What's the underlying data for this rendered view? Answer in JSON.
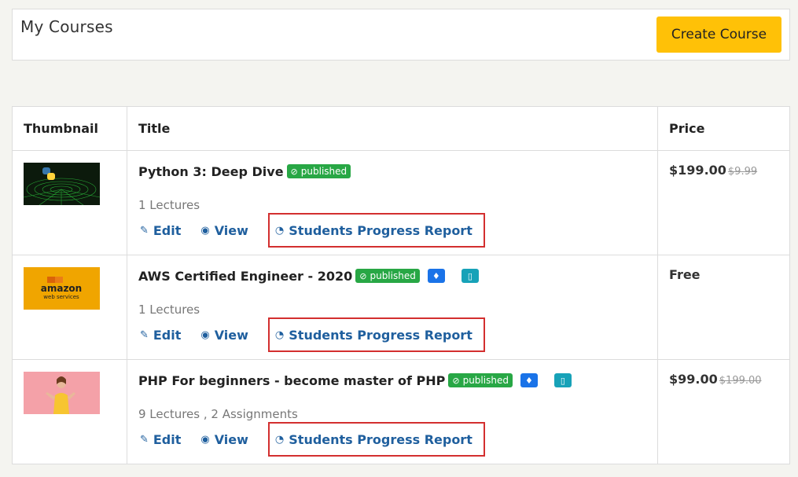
{
  "header": {
    "title": "My Courses",
    "create_label": "Create Course"
  },
  "table": {
    "columns": [
      "Thumbnail",
      "Title",
      "Price"
    ],
    "rows": [
      {
        "title": "Python 3: Deep Dive",
        "status": "published",
        "lectures": "1 Lectures",
        "edit": "Edit",
        "view": "View",
        "report": "Students Progress Report",
        "price": "$199.00",
        "price_old": "$9.99",
        "thumbnail": "python-thumbnail"
      },
      {
        "title": "AWS Certified Engineer - 2020",
        "status": "published",
        "lectures": "1 Lectures",
        "edit": "Edit",
        "view": "View",
        "report": "Students Progress Report",
        "price": "Free",
        "price_old": "",
        "thumbnail": "amazon-web-services-thumbnail",
        "thumb_text_1": "amazon",
        "thumb_text_2": "web services"
      },
      {
        "title": "PHP For beginners - become master of PHP",
        "status": "published",
        "lectures": "9 Lectures , 2 Assignments",
        "edit": "Edit",
        "view": "View",
        "report": "Students Progress Report",
        "price": "$99.00",
        "price_old": "$199.00",
        "thumbnail": "woman-pointing-thumbnail"
      }
    ]
  },
  "colors": {
    "accent_button": "#ffc107",
    "published_badge": "#28a745",
    "link": "#1f5f9e",
    "highlight_border": "#d32f2f"
  }
}
